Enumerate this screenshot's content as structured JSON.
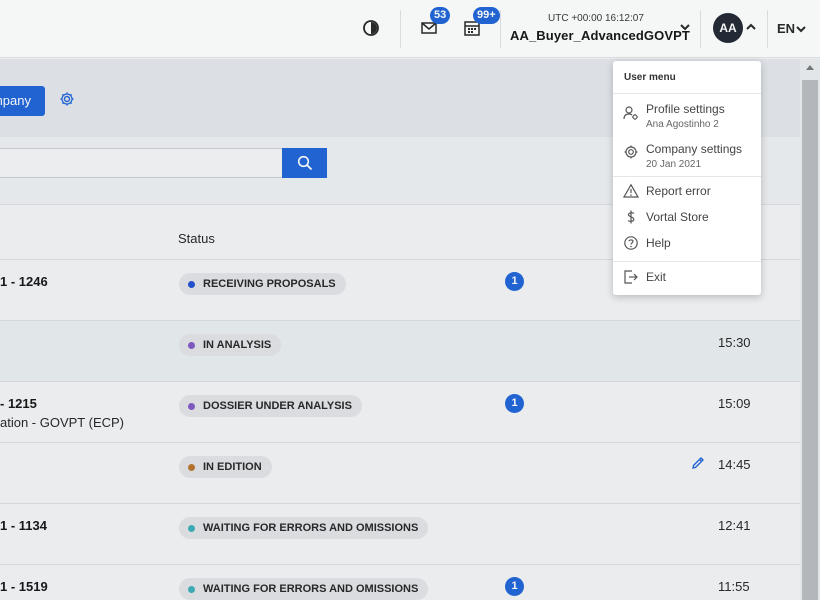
{
  "header": {
    "mail_count": "53",
    "calendar_count": "99+",
    "utc_time": "UTC +00:00 16:12:07",
    "username": "AA_Buyer_AdvancedGOVPT",
    "avatar_initials": "AA",
    "language": "EN"
  },
  "action_bar": {
    "new_company_label": "ompany"
  },
  "table": {
    "status_header": "Status",
    "rows": [
      {
        "id": "1 - 1246",
        "sub": "",
        "status": "RECEIVING PROPOSALS",
        "dot": "#1b4fd1",
        "badge": "1",
        "time": ""
      },
      {
        "id": "",
        "sub": "",
        "status": "IN ANALYSIS",
        "dot": "#7e57c2",
        "badge": "",
        "time": "15:30"
      },
      {
        "id": "- 1215",
        "sub": "ation - GOVPT (ECP)",
        "status": "DOSSIER UNDER ANALYSIS",
        "dot": "#7e57c2",
        "badge": "1",
        "time": "15:09"
      },
      {
        "id": "",
        "sub": "",
        "status": "IN EDITION",
        "dot": "#b87329",
        "badge": "",
        "time": "14:45"
      },
      {
        "id": "1 - 1134",
        "sub": "",
        "status": "WAITING FOR ERRORS AND OMISSIONS",
        "dot": "#3aaeb7",
        "badge": "",
        "time": "12:41"
      },
      {
        "id": "1 - 1519",
        "sub": "",
        "status": "WAITING FOR ERRORS AND OMISSIONS",
        "dot": "#3aaeb7",
        "badge": "1",
        "time": "11:55"
      }
    ]
  },
  "user_menu": {
    "title": "User menu",
    "profile_settings": "Profile settings",
    "profile_name": "Ana Agostinho 2",
    "company_settings": "Company settings",
    "company_date": "20 Jan 2021",
    "report_error": "Report error",
    "vortal_store": "Vortal Store",
    "help": "Help",
    "exit": "Exit"
  },
  "colors": {
    "accent": "#1b62d8",
    "avatar_bg": "#1f2430"
  }
}
